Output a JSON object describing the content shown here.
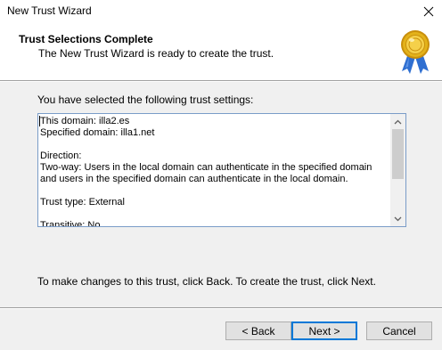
{
  "window": {
    "title": "New Trust Wizard",
    "close_icon": "close-icon"
  },
  "header": {
    "title": "Trust Selections Complete",
    "subtitle": "The New Trust Wizard is ready to create the trust.",
    "icon": "certificate-seal-icon"
  },
  "main": {
    "intro": "You have selected the following trust settings:",
    "settings_lines": [
      "This domain: illa2.es",
      "Specified domain: illa1.net",
      "",
      "Direction:",
      "Two-way: Users in the local domain can authenticate in the specified domain and users in the specified domain can authenticate in the local domain.",
      "",
      "Trust type: External",
      "",
      "Transitive: No"
    ],
    "footer_note": "To make changes to this trust, click Back. To create the trust, click Next."
  },
  "buttons": {
    "back": "< Back",
    "next": "Next >",
    "cancel": "Cancel"
  },
  "colors": {
    "accent": "#0078d7",
    "dialog_bg": "#f0f0f0",
    "seal_gold": "#e3b21a",
    "seal_ribbon": "#2f6fd1"
  }
}
